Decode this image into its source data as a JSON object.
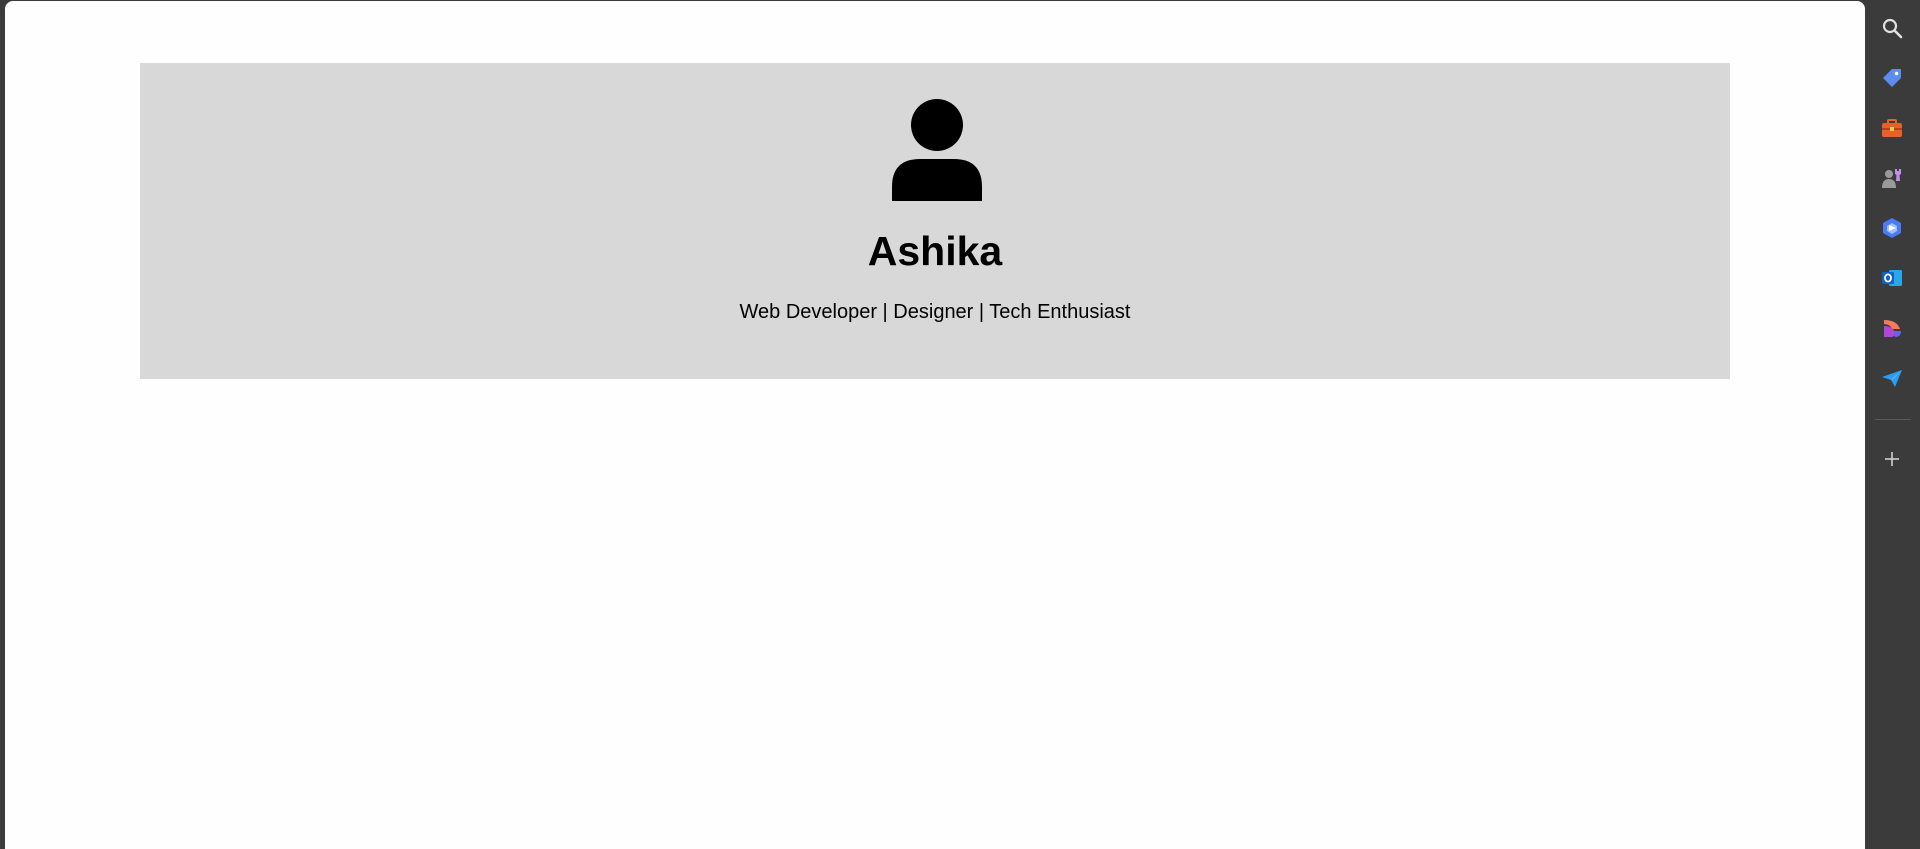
{
  "profile": {
    "name": "Ashika",
    "tagline": "Web Developer | Designer | Tech Enthusiast"
  },
  "sidebar": {
    "items": [
      {
        "icon": "search-icon",
        "color": "#e0e0e0"
      },
      {
        "icon": "tag-icon",
        "color": "#5b8def"
      },
      {
        "icon": "briefcase-icon",
        "color": "#e8602c"
      },
      {
        "icon": "games-icon",
        "color": "#c38cf0"
      },
      {
        "icon": "copilot-icon",
        "color": "#4a7cf7"
      },
      {
        "icon": "outlook-icon",
        "color": "#1a73d9"
      },
      {
        "icon": "designer-icon",
        "color": "#d84bc8"
      },
      {
        "icon": "send-icon",
        "color": "#2d9cf0"
      },
      {
        "icon": "add-icon",
        "color": "#cfcfcf"
      }
    ]
  }
}
